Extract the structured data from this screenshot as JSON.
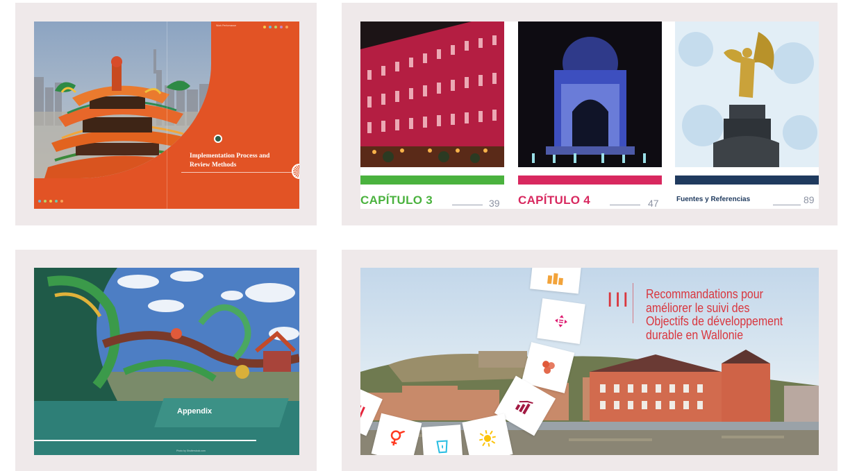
{
  "panel1": {
    "title_line1": "Implementation Process and",
    "title_line2": "Review Methods",
    "header_text": "Work Performance"
  },
  "panel2": {
    "columns": [
      {
        "label": "CAPÍTULO 3",
        "page": "39",
        "color": "#4ab23e"
      },
      {
        "label": "CAPÍTULO 4",
        "page": "47",
        "color": "#d8285f"
      },
      {
        "label": "Fuentes y Referencias",
        "page": "89",
        "color": "#1f3a5e"
      }
    ]
  },
  "panel3": {
    "title": "Appendix",
    "credit": "Photo by Shutterstock.com"
  },
  "panel4": {
    "roman": "III",
    "title_line1": "Recommandations pour",
    "title_line2": "améliorer le suivi des",
    "title_line3": "Objectifs de développement",
    "title_line4": "durable en Wallonie",
    "accent": "#d9363e",
    "icons": [
      "industry-icon",
      "reduced-inequalities-icon",
      "partnership-icon",
      "economic-growth-icon",
      "gender-equality-icon",
      "clean-water-icon",
      "clean-energy-icon",
      "poverty-icon"
    ]
  }
}
